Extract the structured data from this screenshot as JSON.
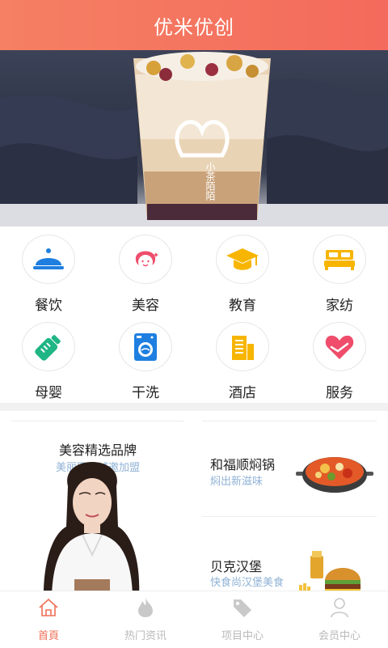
{
  "header": {
    "title": "优米优创"
  },
  "banner": {
    "cup_text": "小茶陌陌"
  },
  "categories": [
    {
      "label": "餐饮",
      "icon": "food-cloche-icon",
      "color": "#1e7fe0"
    },
    {
      "label": "美容",
      "icon": "beauty-face-icon",
      "color": "#ef4d6b"
    },
    {
      "label": "教育",
      "icon": "graduation-cap-icon",
      "color": "#f7b500"
    },
    {
      "label": "家纺",
      "icon": "bed-icon",
      "color": "#f7b500"
    },
    {
      "label": "母婴",
      "icon": "baby-bottle-icon",
      "color": "#1fb585"
    },
    {
      "label": "干洗",
      "icon": "washing-machine-icon",
      "color": "#1e7fe0"
    },
    {
      "label": "酒店",
      "icon": "hotel-building-icon",
      "color": "#f7b500"
    },
    {
      "label": "服务",
      "icon": "heart-hand-icon",
      "color": "#ef4d6b"
    }
  ],
  "promos": {
    "left": {
      "title": "美容精选品牌",
      "subtitle": "美丽田园诚邀加盟"
    },
    "right": [
      {
        "title": "和福顺焖锅",
        "subtitle": "焖出新滋味"
      },
      {
        "title": "贝克汉堡",
        "subtitle": "快食尚汉堡美食"
      }
    ]
  },
  "tabbar": [
    {
      "label": "首頁",
      "icon": "home-icon",
      "active": true
    },
    {
      "label": "热门资讯",
      "icon": "flame-icon",
      "active": false
    },
    {
      "label": "项目中心",
      "icon": "tag-icon",
      "active": false
    },
    {
      "label": "会员中心",
      "icon": "user-icon",
      "active": false
    }
  ],
  "colors": {
    "accent": "#f07057",
    "subtitle": "#8fb2d6",
    "inactive": "#b9b9b9"
  }
}
